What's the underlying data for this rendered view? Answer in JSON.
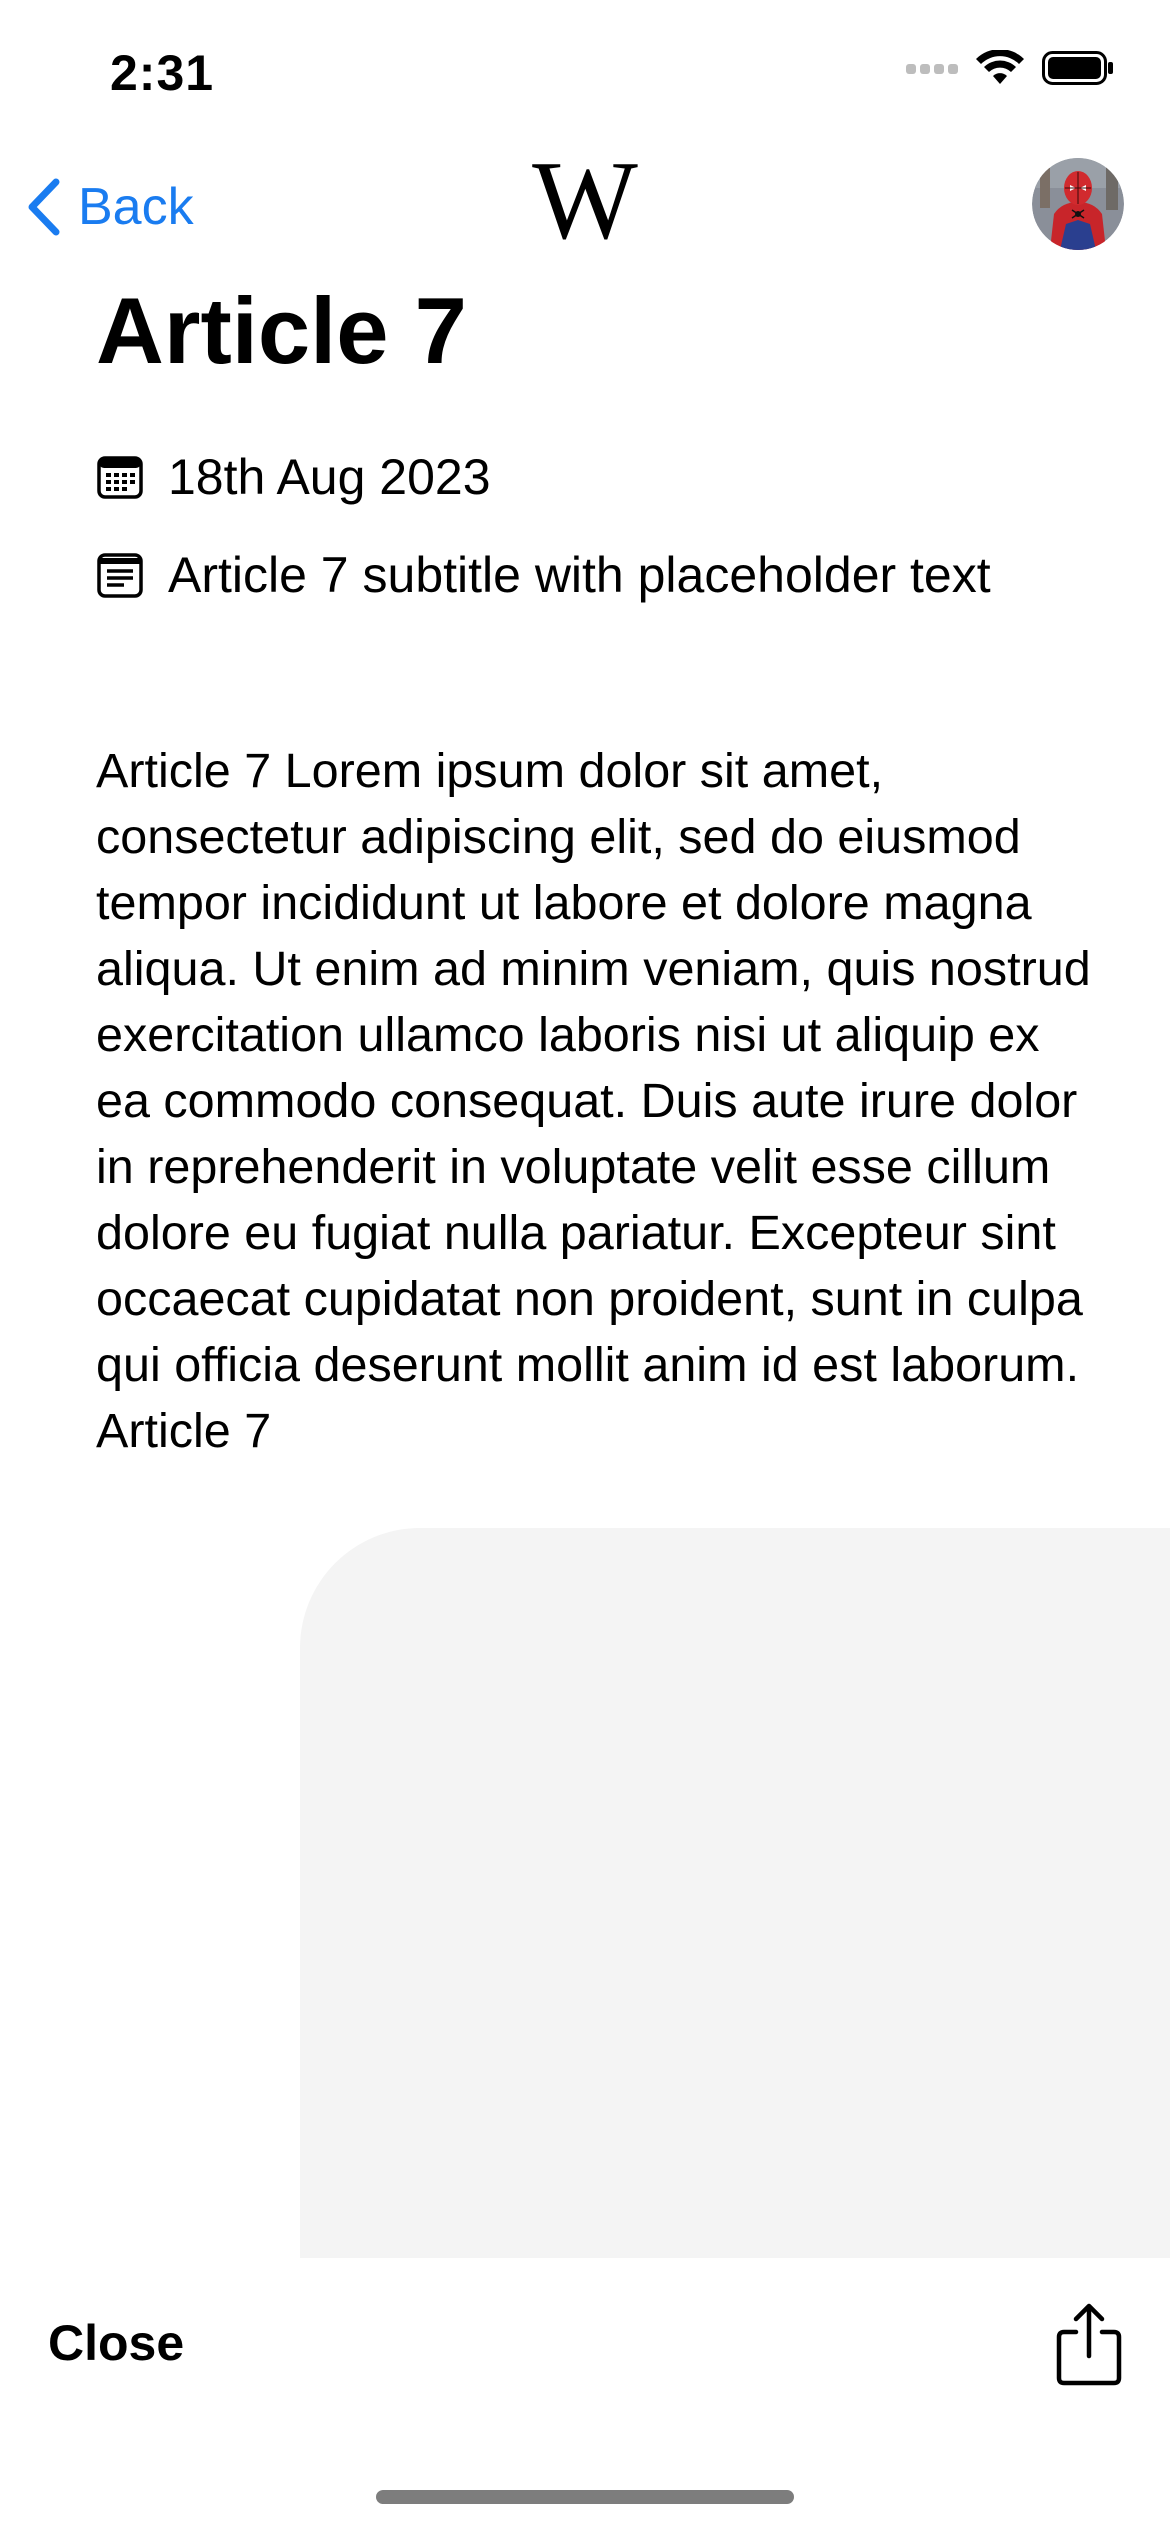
{
  "status_bar": {
    "time": "2:31"
  },
  "nav": {
    "back_label": "Back",
    "logo_letter": "W"
  },
  "article": {
    "title": "Article 7",
    "date": "18th Aug 2023",
    "subtitle": "Article 7 subtitle with placeholder text",
    "body": "Article 7 Lorem ipsum dolor sit amet, consectetur adipiscing elit, sed do eiusmod tempor incididunt ut labore et dolore magna aliqua. Ut enim ad minim veniam, quis nostrud exercitation ullamco laboris nisi ut aliquip ex ea commodo consequat. Duis aute irure dolor in reprehenderit in voluptate velit esse cillum dolore eu fugiat nulla pariatur. Excepteur sint occaecat cupidatat non proident, sunt in culpa qui officia deserunt mollit anim id est laborum. Article 7"
  },
  "toolbar": {
    "close_label": "Close"
  },
  "icons": {
    "back": "chevron-left-icon",
    "date": "calendar-icon",
    "subtitle": "document-text-icon",
    "share": "share-icon",
    "wifi": "wifi-icon",
    "battery": "battery-icon",
    "signal": "cellular-signal-icon"
  },
  "colors": {
    "accent": "#1a7cf0",
    "panel_background": "#f4f4f4"
  }
}
